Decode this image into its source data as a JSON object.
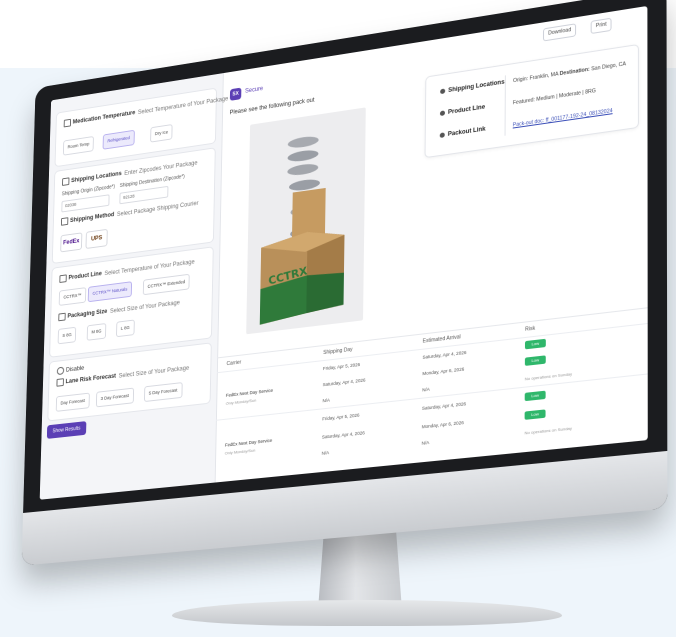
{
  "toolbar": {
    "download_label": "Download",
    "print_label": "Print"
  },
  "brand": {
    "badge": "SX",
    "name": "Secure"
  },
  "heading": "Please see the following pack out",
  "info": {
    "shipping_locations_label": "Shipping Locations",
    "shipping_locations_origin_label": "Origin:",
    "shipping_locations_origin": "Franklin, MA",
    "shipping_locations_destination_label": "Destination:",
    "shipping_locations_destination": "San Diego, CA",
    "product_line_label": "Product Line",
    "product_line_value": "Featured: Medium | Moderate | 8RG",
    "packout_link_label": "Packout Link",
    "packout_link_value": "Pack-out doc: ff_001177-192-24_08132024"
  },
  "left": {
    "medication": {
      "title": "Medication Temperature",
      "subtitle": "Select Temperature of Your Package",
      "options": [
        "Room Temp",
        "Refrigerated",
        "Dry Ice"
      ]
    },
    "locations": {
      "title": "Shipping Locations",
      "subtitle": "Enter Zipcodes Your Package",
      "origin_label": "Shipping Origin (Zipcode*)",
      "origin_value": "02038",
      "dest_label": "Shipping Destination (Zipcode*)",
      "dest_value": "92128"
    },
    "method": {
      "title": "Shipping Method",
      "subtitle": "Select Package Shipping Courier",
      "couriers": [
        "FedEx",
        "UPS"
      ]
    },
    "product_line": {
      "title": "Product Line",
      "subtitle": "Select Temperature of Your Package",
      "options": [
        "CCTRX™",
        "CCTRX™ Naturals",
        "CCTRX™ Extended"
      ]
    },
    "packaging": {
      "title": "Packaging Size",
      "subtitle": "Select Size of Your Package",
      "options": [
        "S 8G",
        "M 8G",
        "L 8G"
      ]
    },
    "disable_label": "Disable",
    "risk": {
      "title": "Lane Risk Forecast",
      "subtitle": "Select Size of Your Package",
      "options": [
        "Day Forecast",
        "3 Day Forecast",
        "5 Day Forecast"
      ]
    },
    "show_results": "Show Results"
  },
  "table": {
    "headers": [
      "Carrier",
      "Shipping Day",
      "Estimated Arrival",
      "Risk"
    ],
    "groups": [
      {
        "carrier": "FedEx Next Day Service",
        "sub": "Only Monday/Sun",
        "rows": [
          {
            "ship": "Friday, Apr 5, 2026",
            "arrive": "Saturday, Apr 4, 2026",
            "risk": "Low"
          },
          {
            "ship": "Saturday, Apr 4, 2026",
            "arrive": "Monday, Apr 6, 2026",
            "risk": "Low"
          },
          {
            "ship": "N/A",
            "arrive": "N/A",
            "risk": "No operations on Sunday"
          }
        ]
      },
      {
        "carrier": "FedEx Next Day Service",
        "sub": "Only Monday/Sun",
        "rows": [
          {
            "ship": "Friday, Apr 5, 2026",
            "arrive": "Saturday, Apr 4, 2026",
            "risk": "Low"
          },
          {
            "ship": "Saturday, Apr 4, 2026",
            "arrive": "Monday, Apr 6, 2026",
            "risk": "Low"
          },
          {
            "ship": "N/A",
            "arrive": "N/A",
            "risk": "No operations on Sunday"
          }
        ]
      }
    ]
  },
  "product_image": {
    "box_text": "CCTRX"
  },
  "colors": {
    "accent": "#5b3fb5",
    "low_risk": "#2fb76b",
    "background": "#eef5fb"
  }
}
